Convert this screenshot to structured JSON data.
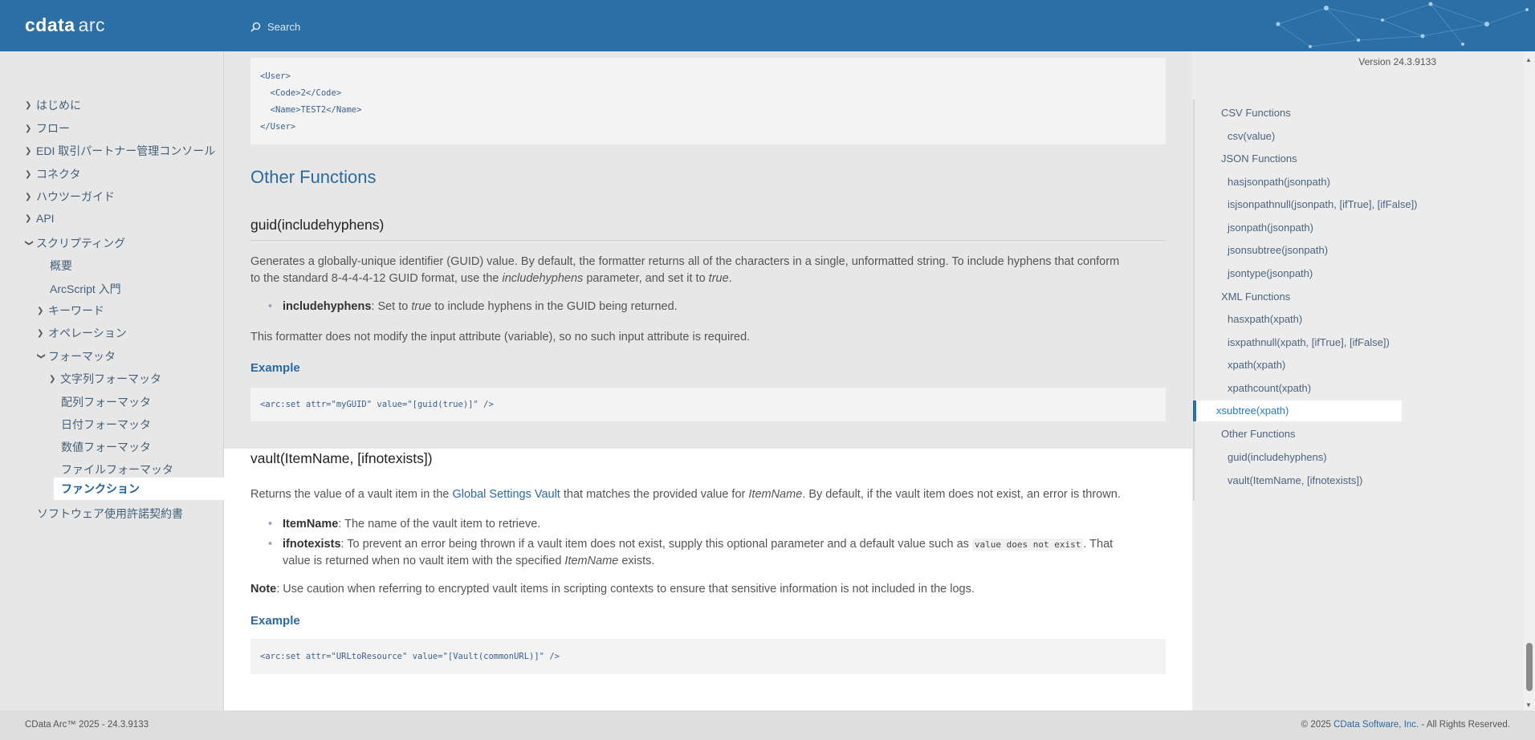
{
  "header": {
    "logo_bold": "cdata",
    "logo_light": "arc",
    "search_label": "Search"
  },
  "version": "Version 24.3.9133",
  "sidebar": {
    "items": [
      {
        "label": "はじめに"
      },
      {
        "label": "フロー"
      },
      {
        "label": "EDI 取引パートナー管理コンソール"
      },
      {
        "label": "コネクタ"
      },
      {
        "label": "ハウツーガイド"
      },
      {
        "label": "API"
      },
      {
        "label": "スクリプティング"
      },
      {
        "label": "概要"
      },
      {
        "label": "ArcScript 入門"
      },
      {
        "label": "キーワード"
      },
      {
        "label": "オペレーション"
      },
      {
        "label": "フォーマッタ"
      },
      {
        "label": "文字列フォーマッタ"
      },
      {
        "label": "配列フォーマッタ"
      },
      {
        "label": "日付フォーマッタ"
      },
      {
        "label": "数値フォーマッタ"
      },
      {
        "label": "ファイルフォーマッタ"
      },
      {
        "label": "ファンクション"
      },
      {
        "label": "ソフトウェア使用許諾契約書"
      }
    ]
  },
  "main": {
    "xml_lines": [
      "<User>",
      "  <Code>2</Code>",
      "  <Name>TEST2</Name>",
      "</User>"
    ],
    "section_title": "Other Functions",
    "guid": {
      "title": "guid(includehyphens)",
      "desc_line1": "Generates a globally-unique identifier (GUID) value. By default, the formatter returns all of the characters in a single, unformatted string. To include hyphens that conform",
      "desc_line2_a": "to the standard 8-4-4-4-12 GUID format, use the ",
      "desc_line2_em": "includehyphens",
      "desc_line2_b": " parameter, and set it to ",
      "desc_line2_em2": "true",
      "desc_line2_c": ".",
      "param_name": "includehyphens",
      "param_a": ": Set to ",
      "param_em": "true",
      "param_b": " to include hyphens in the GUID being returned.",
      "note": "This formatter does not modify the input attribute (variable), so no such input attribute is required.",
      "example_label": "Example",
      "code": "<arc:set attr=\"myGUID\" value=\"[guid(true)]\" />"
    },
    "vault": {
      "title": "vault(ItemName, [ifnotexists])",
      "desc_a": "Returns the value of a vault item in the ",
      "desc_link": "Global Settings Vault",
      "desc_b": " that matches the provided value for ",
      "desc_em": "ItemName",
      "desc_c": ". By default, if the vault item does not exist, an error is thrown.",
      "p1_name": "ItemName",
      "p1_text": ": The name of the vault item to retrieve.",
      "p2_name": "ifnotexists",
      "p2_text": ": To prevent an error being thrown if a vault item does not exist, supply this optional parameter and a default value such as ",
      "p2_code": "value does not exist",
      "p2_text2": ". That",
      "p2_line2_a": "value is returned when no vault item with the specified ",
      "p2_line2_em": "ItemName",
      "p2_line2_b": " exists.",
      "note_label": "Note",
      "note_text": ": Use caution when referring to encrypted vault items in scripting contexts to ensure that sensitive information is not included in the logs.",
      "example_label": "Example",
      "code": "<arc:set attr=\"URLtoResource\" value=\"[Vault(commonURL)]\" />"
    }
  },
  "toc": {
    "items": [
      {
        "label": "CSV Functions"
      },
      {
        "label": "csv(value)"
      },
      {
        "label": "JSON Functions"
      },
      {
        "label": "hasjsonpath(jsonpath)"
      },
      {
        "label": "isjsonpathnull(jsonpath, [ifTrue], [ifFalse])"
      },
      {
        "label": "jsonpath(jsonpath)"
      },
      {
        "label": "jsonsubtree(jsonpath)"
      },
      {
        "label": "jsontype(jsonpath)"
      },
      {
        "label": "XML Functions"
      },
      {
        "label": "hasxpath(xpath)"
      },
      {
        "label": "isxpathnull(xpath, [ifTrue], [ifFalse])"
      },
      {
        "label": "xpath(xpath)"
      },
      {
        "label": "xpathcount(xpath)"
      },
      {
        "label": "xsubtree(xpath)"
      },
      {
        "label": "Other Functions"
      },
      {
        "label": "guid(includehyphens)"
      },
      {
        "label": "vault(ItemName, [ifnotexists])"
      }
    ]
  },
  "footer": {
    "left": "CData Arc™ 2025 - 24.3.9133",
    "right_a": "© 2025 ",
    "right_link": "CData Software, Inc.",
    "right_b": " - All Rights Reserved."
  }
}
